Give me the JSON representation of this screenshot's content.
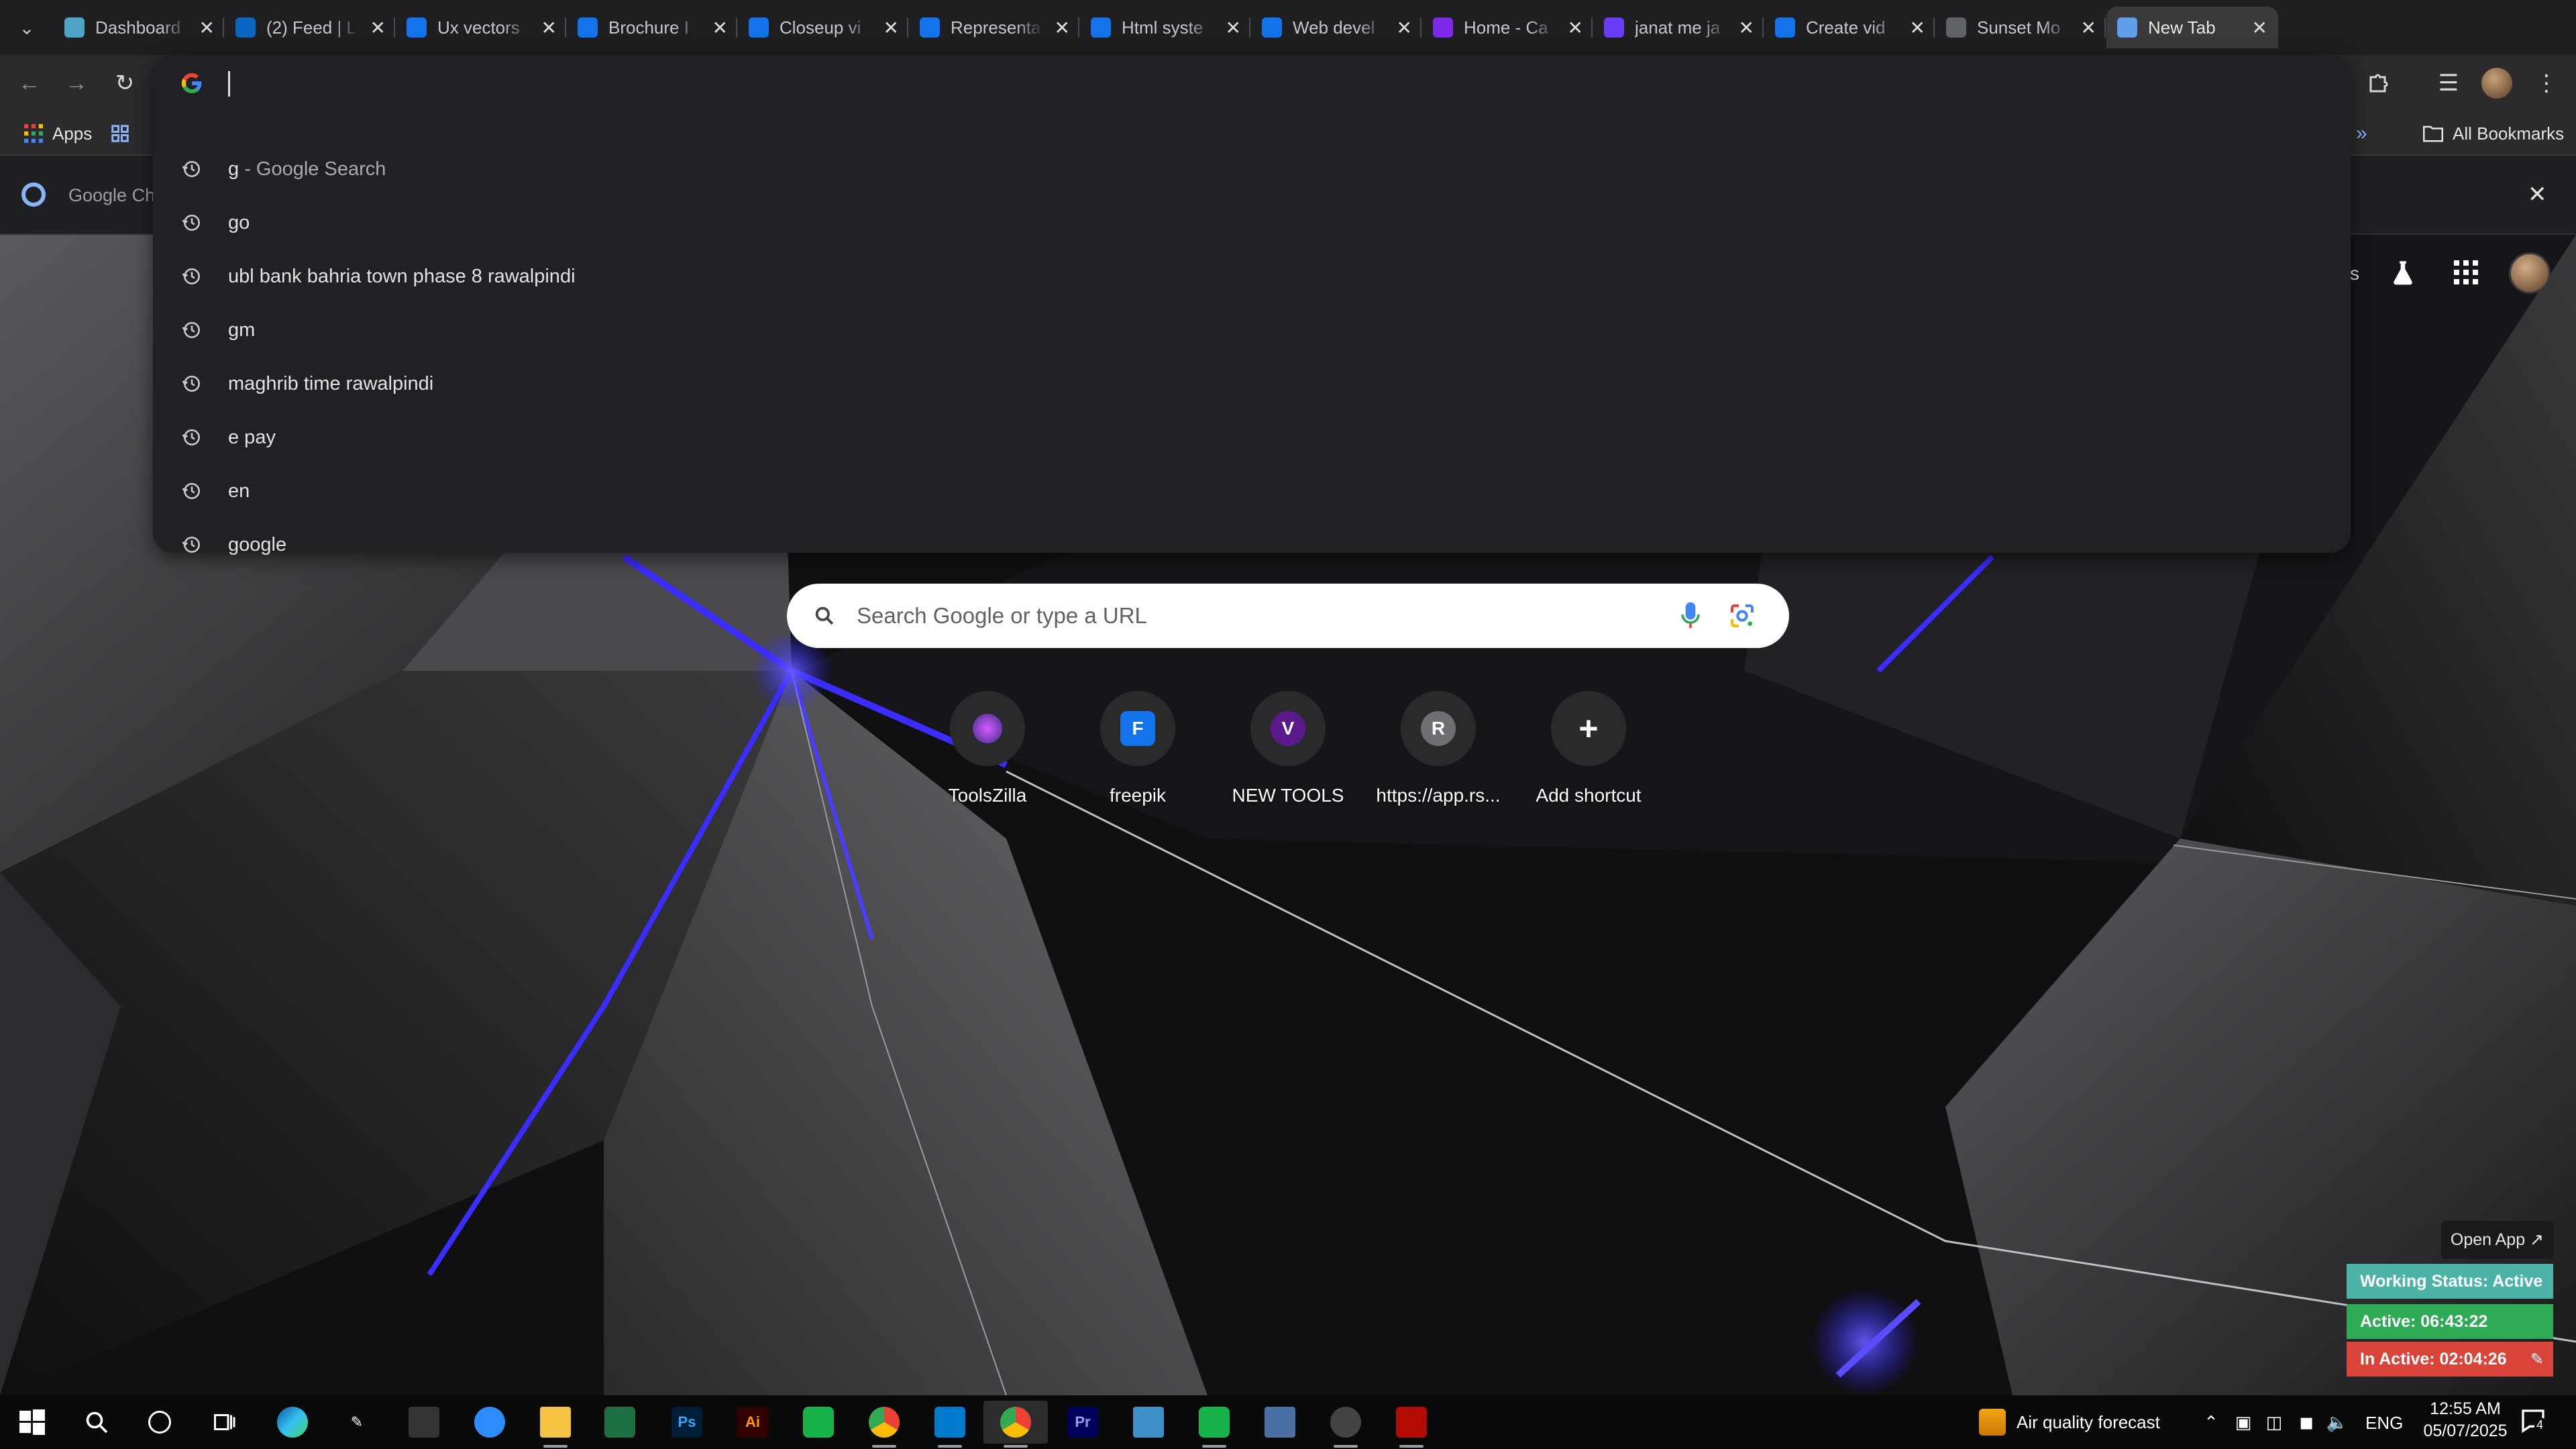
{
  "tabs": [
    {
      "title": "Dashboard",
      "icon": "dashboard-icon",
      "color": "#4fa3c7"
    },
    {
      "title": "(2) Feed | L",
      "icon": "linkedin-icon",
      "color": "#0a66c2"
    },
    {
      "title": "Ux vectors",
      "icon": "freepik-icon",
      "color": "#1273eb"
    },
    {
      "title": "Brochure I",
      "icon": "freepik-icon",
      "color": "#1273eb"
    },
    {
      "title": "Closeup vi",
      "icon": "freepik-icon",
      "color": "#1273eb"
    },
    {
      "title": "Representa",
      "icon": "freepik-icon",
      "color": "#1273eb"
    },
    {
      "title": "Html syste",
      "icon": "freepik-icon",
      "color": "#1273eb"
    },
    {
      "title": "Web devel",
      "icon": "freepik-icon",
      "color": "#1273eb"
    },
    {
      "title": "Home - Ca",
      "icon": "canva-icon",
      "color": "#7d2ae8"
    },
    {
      "title": "janat me ja",
      "icon": "video-icon",
      "color": "#6a3cf5"
    },
    {
      "title": "Create vid",
      "icon": "freepik-icon",
      "color": "#1273eb"
    },
    {
      "title": "Sunset Mo",
      "icon": "openai-icon",
      "color": "#5f6368"
    },
    {
      "title": "New Tab",
      "icon": "chrome-icon",
      "color": "#5f9ee8"
    }
  ],
  "bookmarks": {
    "apps_label": "Apps",
    "all_bookmarks_label": "All Bookmarks"
  },
  "infobar": {
    "text": "Google Ch"
  },
  "omnibox": {
    "suggestions": [
      {
        "text": "g",
        "suffix": " - Google Search"
      },
      {
        "text": "go",
        "suffix": ""
      },
      {
        "text": "ubl bank bahria town phase 8 rawalpindi",
        "suffix": ""
      },
      {
        "text": "gm",
        "suffix": ""
      },
      {
        "text": "maghrib time rawalpindi",
        "suffix": ""
      },
      {
        "text": "e pay",
        "suffix": ""
      },
      {
        "text": "en",
        "suffix": ""
      },
      {
        "text": "google",
        "suffix": ""
      }
    ]
  },
  "search": {
    "placeholder": "Search Google or type a URL"
  },
  "shortcuts": [
    {
      "label": "ToolsZilla",
      "glyph": "",
      "icon": "toolszilla-icon",
      "color": "#6b3fa0"
    },
    {
      "label": "freepik",
      "glyph": "F",
      "icon": "freepik-icon",
      "color": "#1273eb"
    },
    {
      "label": "NEW TOOLS",
      "glyph": "V",
      "icon": "letter-v-icon",
      "color": "#5b1a8c"
    },
    {
      "label": "https://app.rs...",
      "glyph": "R",
      "icon": "letter-r-icon",
      "color": "#6f6f73"
    },
    {
      "label": "Add shortcut",
      "glyph": "+",
      "icon": "plus-icon",
      "color": "#2a2a2c"
    }
  ],
  "tracker": {
    "open_app": "Open App ↗",
    "working_status": "Working Status: Active",
    "active": "Active: 06:43:22",
    "inactive": "In Active: 02:04:26",
    "colors": {
      "status": "#4db3a6",
      "active": "#2faa55",
      "inactive": "#d9453b"
    }
  },
  "taskbar": {
    "weather": "Air quality forecast",
    "lang": "ENG",
    "time": "12:55 AM",
    "date": "05/07/2025",
    "notification_count": "4"
  },
  "colors": {
    "window_controls": "#1a73e8",
    "accent_blue": "#3b2cff"
  }
}
